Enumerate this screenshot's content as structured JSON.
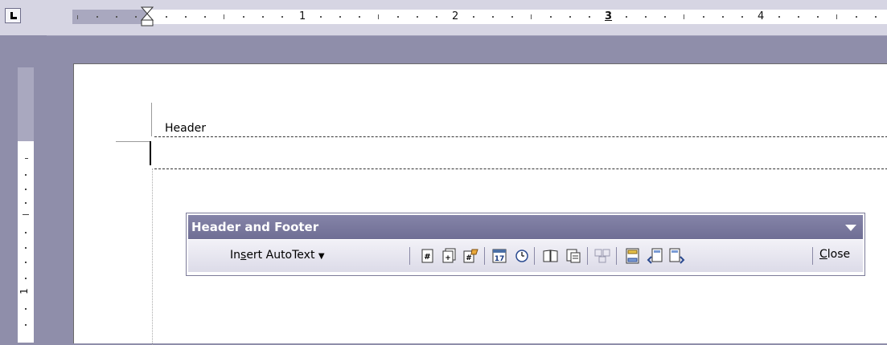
{
  "ruler": {
    "numbers": [
      "1",
      "2",
      "3",
      "4"
    ]
  },
  "document": {
    "header_label": "Header"
  },
  "toolbar": {
    "title": "Header and Footer",
    "insert_autotext": {
      "prefix": "In",
      "accel": "s",
      "suffix": "ert AutoText"
    },
    "close": {
      "accel": "C",
      "suffix": "lose"
    },
    "icons": [
      "insert-page-number-icon",
      "insert-number-of-pages-icon",
      "format-page-number-icon",
      "insert-date-icon",
      "insert-time-icon",
      "page-setup-icon",
      "show-hide-document-text-icon",
      "same-as-previous-icon",
      "switch-header-footer-icon",
      "show-previous-icon",
      "show-next-icon"
    ]
  },
  "colors": {
    "chrome": "#8f8eaa",
    "title_bar": "#6f6e94",
    "page": "#ffffff"
  }
}
